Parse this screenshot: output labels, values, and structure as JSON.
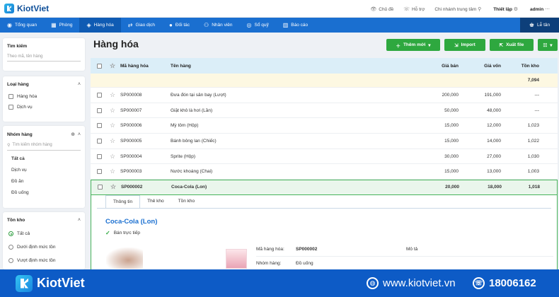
{
  "app": {
    "brand": "KiotViet"
  },
  "topbar": {
    "theme": "Chủ đề",
    "help": "Hỗ trợ",
    "branch": "Chi nhánh trung tâm",
    "settings": "Thiết lập",
    "user": "admin"
  },
  "nav": {
    "items": [
      {
        "label": "Tổng quan",
        "icon": "eye-icon"
      },
      {
        "label": "Phòng",
        "icon": "grid-icon"
      },
      {
        "label": "Hàng hóa",
        "icon": "box-icon"
      },
      {
        "label": "Giao dịch",
        "icon": "swap-icon"
      },
      {
        "label": "Đối tác",
        "icon": "person-icon"
      },
      {
        "label": "Nhân viên",
        "icon": "people-icon"
      },
      {
        "label": "Sổ quỹ",
        "icon": "coin-icon"
      },
      {
        "label": "Báo cáo",
        "icon": "chart-icon"
      }
    ],
    "reception": "Lễ tân"
  },
  "sidebar": {
    "search": {
      "title": "Tìm kiếm",
      "placeholder": "Theo mã, tên hàng"
    },
    "type": {
      "title": "Loại hàng",
      "options": [
        "Hàng hóa",
        "Dịch vụ"
      ]
    },
    "group": {
      "title": "Nhóm hàng",
      "placeholder": "Tìm kiếm nhóm hàng",
      "items": [
        "Tất cả",
        "Dịch vụ",
        "Đồ ăn",
        "Đồ uống"
      ]
    },
    "stock": {
      "title": "Tồn kho",
      "options": [
        "Tất cả",
        "Dưới định mức tồn",
        "Vượt định mức tồn"
      ]
    }
  },
  "main": {
    "title": "Hàng hóa",
    "buttons": {
      "add": "Thêm mới",
      "import": "Import",
      "export": "Xuất file"
    },
    "columns": {
      "code": "Mã hàng hóa",
      "name": "Tên hàng",
      "price": "Giá bán",
      "cost": "Giá vốn",
      "stock": "Tồn kho"
    },
    "total_stock": "7,094",
    "rows": [
      {
        "code": "SP000008",
        "name": "Đưa đón tại sân bay (Lượt)",
        "price": "200,000",
        "cost": "191,000",
        "stock": "---"
      },
      {
        "code": "SP000007",
        "name": "Giặt khô là hơi (Lần)",
        "price": "50,000",
        "cost": "48,000",
        "stock": "---"
      },
      {
        "code": "SP000006",
        "name": "Mỳ tôm (Hộp)",
        "price": "15,000",
        "cost": "12,000",
        "stock": "1,023"
      },
      {
        "code": "SP000005",
        "name": "Bánh bông lan (Chiếc)",
        "price": "15,000",
        "cost": "14,000",
        "stock": "1,022"
      },
      {
        "code": "SP000004",
        "name": "Sprite (Hộp)",
        "price": "30,000",
        "cost": "27,000",
        "stock": "1,030"
      },
      {
        "code": "SP000003",
        "name": "Nước khoáng (Chai)",
        "price": "15,000",
        "cost": "13,000",
        "stock": "1,003"
      }
    ],
    "selected": {
      "code": "SP000002",
      "name": "Coca-Cola (Lon)",
      "price": "20,000",
      "cost": "18,000",
      "stock": "1,018"
    }
  },
  "detail": {
    "tabs": [
      "Thông tin",
      "Thẻ kho",
      "Tồn kho"
    ],
    "title": "Coca-Cola (Lon)",
    "sell_direct": "Bán trực tiếp",
    "code_label": "Mã hàng hóa:",
    "code_value": "SP000002",
    "desc_label": "Mô tả",
    "group_label": "Nhóm hàng:",
    "group_value": "Đồ uống"
  },
  "footer": {
    "brand": "KiotViet",
    "website": "www.kiotviet.vn",
    "phone": "18006162"
  },
  "colors": {
    "primary": "#1a6fd0",
    "green": "#2ea83f",
    "footer": "#0d5bc6"
  }
}
